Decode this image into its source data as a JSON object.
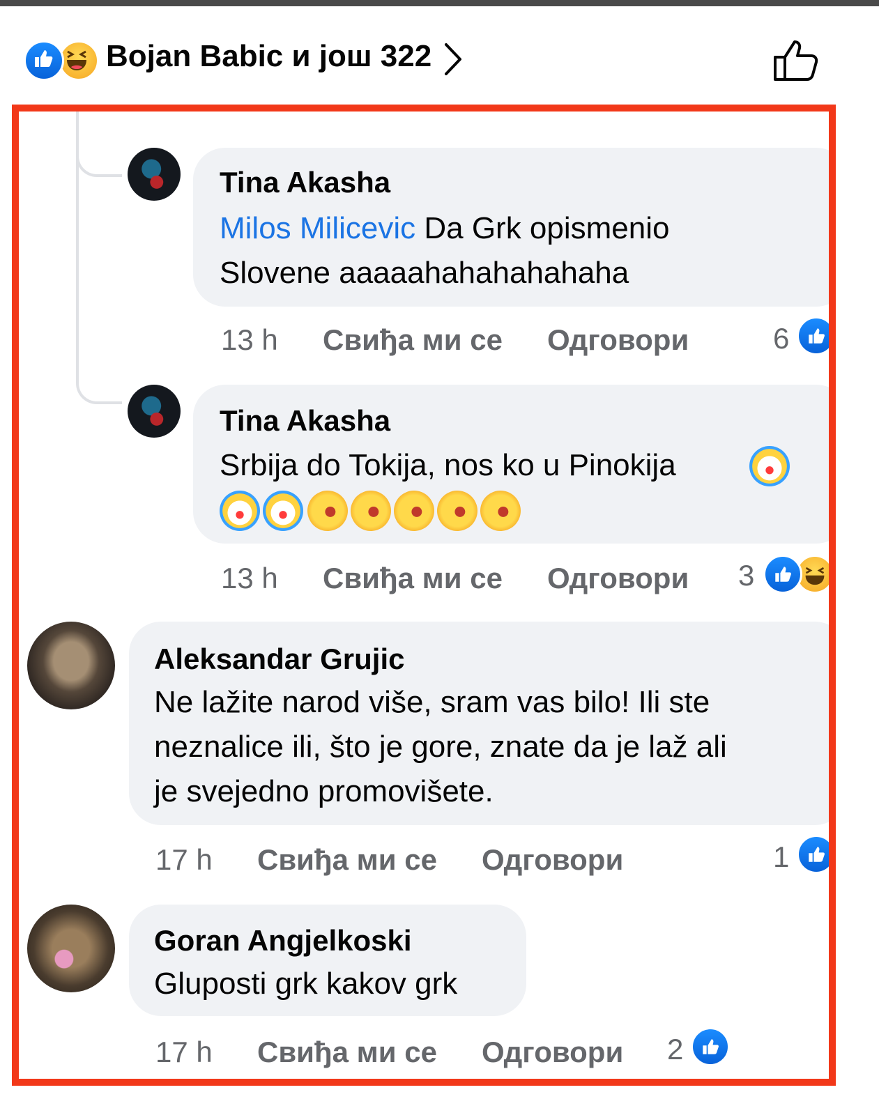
{
  "header": {
    "reactions_label": "Bojan Babic и још 322",
    "reaction_icons": [
      "like-icon",
      "haha-icon"
    ],
    "chevron_icon": "chevron-right-icon",
    "like_button_icon": "thumbs-up-outline-icon"
  },
  "comments": [
    {
      "author": "Tina Akasha",
      "mention": "Milos Milicevic",
      "text_line1": " Da Grk opismenio",
      "text_line2": "Slovene aaaaahahahahahaha",
      "time": "13 h",
      "like_label": "Свиђа ми се",
      "reply_label": "Одговори",
      "reaction_count": "6",
      "reaction_icons": [
        "like-icon"
      ]
    },
    {
      "author": "Tina Akasha",
      "text_line1": "Srbija do Tokija, nos ko u Pinokija",
      "emojis": [
        "clown-face",
        "clown-face",
        "clown-face",
        "rofl",
        "rofl",
        "rofl",
        "rofl",
        "rofl"
      ],
      "time": "13 h",
      "like_label": "Свиђа ми се",
      "reply_label": "Одговори",
      "reaction_count": "3",
      "reaction_icons": [
        "like-icon",
        "haha-icon"
      ]
    },
    {
      "author": "Aleksandar Grujic",
      "text_line1": "Ne lažite narod više, sram vas bilo! Ili ste",
      "text_line2": "neznalice ili, što je gore, znate da je laž ali",
      "text_line3": "je svejedno promovišete.",
      "time": "17 h",
      "like_label": "Свиђа ми се",
      "reply_label": "Одговори",
      "reaction_count": "1",
      "reaction_icons": [
        "like-icon"
      ]
    },
    {
      "author": "Goran Angjelkoski",
      "text_line1": "Gluposti grk kakov grk",
      "time": "17 h",
      "like_label": "Свиђа ми се",
      "reply_label": "Одговори",
      "reaction_count": "2",
      "reaction_icons": [
        "like-icon"
      ]
    }
  ],
  "colors": {
    "highlight_border": "#f23819",
    "bubble": "#f0f2f5",
    "mention": "#1b74e4",
    "meta_text": "#65676b",
    "like_blue": "#1877f2"
  }
}
